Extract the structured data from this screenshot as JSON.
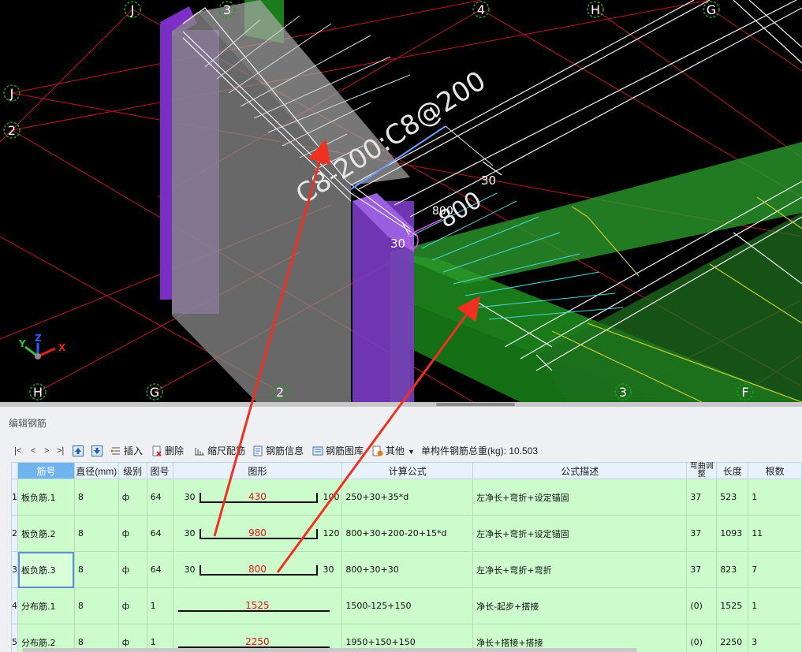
{
  "viewport": {
    "axis_labels": {
      "top": [
        "J",
        "3",
        "4",
        "H",
        "G"
      ],
      "left": [
        "J",
        "2"
      ],
      "bottom": [
        "H",
        "G",
        "2",
        "3",
        "F"
      ]
    },
    "annotation_main": "C8-200:C8@200",
    "annotation_len": "800",
    "dim_30_right": "30",
    "dim_30_left": "30",
    "dim_800_small": "800",
    "gizmo": {
      "x": "X",
      "y": "Y",
      "z": "Z"
    }
  },
  "panel": {
    "title": "编辑钢筋",
    "toolbar": {
      "nav": [
        "|<",
        "<",
        ">",
        ">|"
      ],
      "insert": "插入",
      "delete": "删除",
      "scale": "缩尺配筋",
      "info": "钢筋信息",
      "library": "钢筋图库",
      "other": "其他",
      "weight_label": "单构件钢筋总重(kg):",
      "weight_value": "10.503"
    },
    "columns": [
      "筋号",
      "直径(mm)",
      "级别",
      "图号",
      "图形",
      "计算公式",
      "公式描述",
      "弯曲调整",
      "长度",
      "根数"
    ],
    "rows": [
      {
        "num": "1",
        "name": "板负筋.1",
        "dia": "8",
        "grade": "ф",
        "fig": "64",
        "left": "30",
        "mid": "430",
        "right": "100",
        "formula": "250+30+35*d",
        "desc": "左净长+弯折+设定锚固",
        "bend": "37",
        "len": "523",
        "count": "1"
      },
      {
        "num": "2",
        "name": "板负筋.2",
        "dia": "8",
        "grade": "ф",
        "fig": "64",
        "left": "30",
        "mid": "980",
        "right": "120",
        "formula": "800+30+200-20+15*d",
        "desc": "左净长+弯折+设定锚固",
        "bend": "37",
        "len": "1093",
        "count": "11"
      },
      {
        "num": "3",
        "name": "板负筋.3",
        "dia": "8",
        "grade": "ф",
        "fig": "64",
        "left": "30",
        "mid": "800",
        "right": "30",
        "formula": "800+30+30",
        "desc": "左净长+弯折+弯折",
        "bend": "37",
        "len": "823",
        "count": "7"
      },
      {
        "num": "4",
        "name": "分布筋.1",
        "dia": "8",
        "grade": "ф",
        "fig": "1",
        "left": "",
        "mid": "1525",
        "right": "",
        "formula": "1500-125+150",
        "desc": "净长-起步+搭接",
        "bend": "(0)",
        "len": "1525",
        "count": "1"
      },
      {
        "num": "5",
        "name": "分布筋.2",
        "dia": "8",
        "grade": "ф",
        "fig": "1",
        "left": "",
        "mid": "2250",
        "right": "",
        "formula": "1950+150+150",
        "desc": "净长+搭接+搭接",
        "bend": "(0)",
        "len": "2250",
        "count": "3"
      }
    ]
  },
  "colors": {
    "grid_bg": "#ccfccc",
    "header_bg": "#e8f2fc",
    "accent_red": "#e2141b",
    "arrow_red": "#f03020"
  }
}
